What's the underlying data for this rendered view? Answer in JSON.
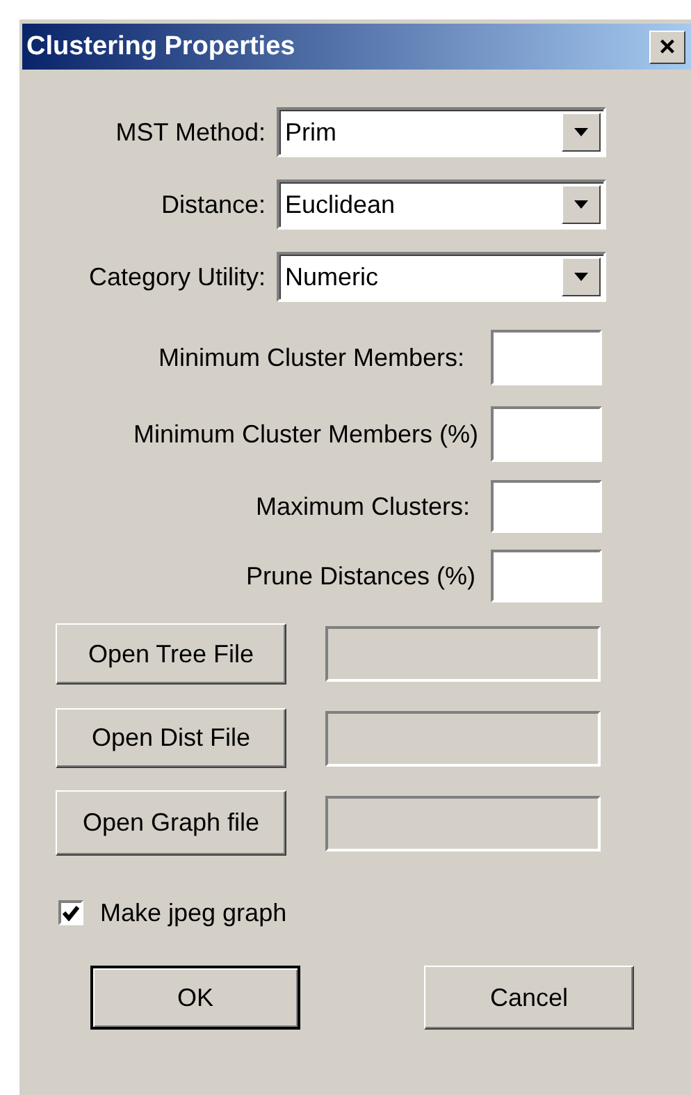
{
  "window": {
    "title": "Clustering Properties",
    "close": "×"
  },
  "dropdowns": [
    {
      "label": "MST Method:",
      "value": "Prim"
    },
    {
      "label": "Distance:",
      "value": "Euclidean"
    },
    {
      "label": "Category Utility:",
      "value": "Numeric"
    }
  ],
  "number_fields": [
    {
      "label": "Minimum Cluster Members:"
    },
    {
      "label": "Minimum Cluster Members (%)"
    },
    {
      "label": "Maximum Clusters:"
    },
    {
      "label": "Prune Distances (%)"
    }
  ],
  "file_rows": [
    {
      "button": "Open Tree File",
      "disabled": true
    },
    {
      "button": "Open Dist File",
      "disabled": true
    },
    {
      "button": "Open Graph file",
      "disabled": true
    }
  ],
  "checkbox": {
    "label": "Make jpeg graph",
    "checked": true
  },
  "buttons": [
    {
      "label": "OK",
      "default": true
    },
    {
      "label": "Cancel",
      "default": false
    }
  ]
}
